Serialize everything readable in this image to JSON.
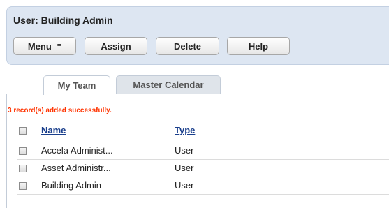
{
  "header": {
    "title": "User: Building Admin",
    "buttons": {
      "menu": "Menu",
      "menu_icon": "≡",
      "assign": "Assign",
      "delete": "Delete",
      "help": "Help"
    }
  },
  "tabs": [
    {
      "label": "My Team",
      "active": true
    },
    {
      "label": "Master Calendar",
      "active": false
    }
  ],
  "status_message": "3 record(s) added successfully.",
  "table": {
    "columns": [
      "Name",
      "Type"
    ],
    "rows": [
      {
        "name": "Accela Administ...",
        "type": "User"
      },
      {
        "name": "Asset Administr...",
        "type": "User"
      },
      {
        "name": "Building Admin",
        "type": "User"
      }
    ]
  },
  "colors": {
    "header_bg": "#dde6f2",
    "success": "#ff3300",
    "link": "#1a3f8c"
  }
}
